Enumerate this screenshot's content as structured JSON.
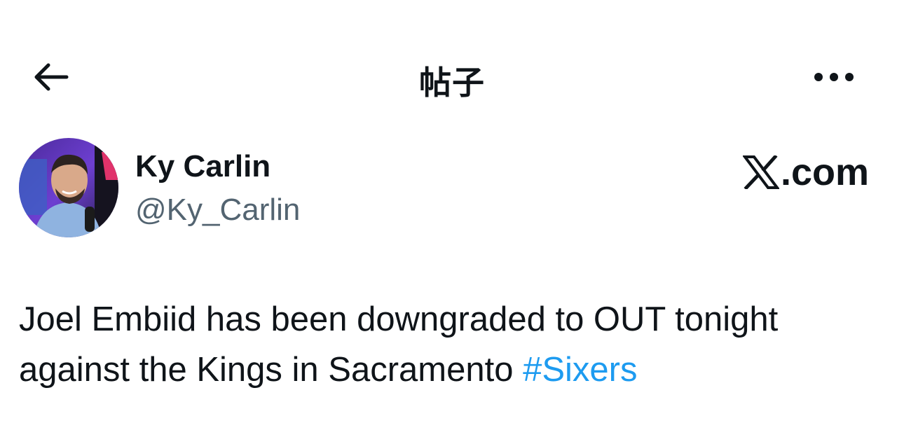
{
  "header": {
    "title": "帖子",
    "back_icon": "arrow-left-icon",
    "more_icon": "more-horizontal-icon"
  },
  "author": {
    "display_name": "Ky Carlin",
    "handle": "@Ky_Carlin"
  },
  "branding": {
    "logo_text": ".com",
    "logo_icon": "x-logo-icon"
  },
  "post": {
    "text": "Joel Embiid has been downgraded to OUT tonight against the Kings in Sacramento",
    "hashtag": "#Sixers"
  },
  "colors": {
    "text": "#0f1419",
    "secondary_text": "#536471",
    "link": "#1d9bf0",
    "background": "#ffffff"
  }
}
